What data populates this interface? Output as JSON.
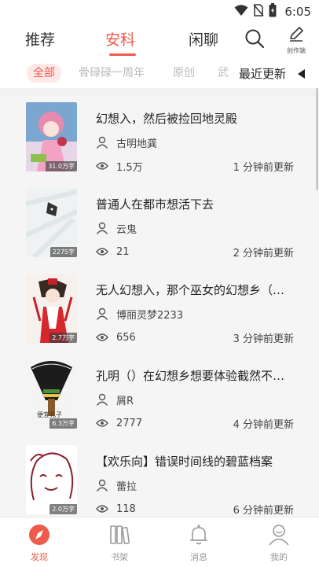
{
  "status_bar": {
    "time": "6:05"
  },
  "top_tabs": [
    {
      "label": "推荐",
      "active": false
    },
    {
      "label": "安科",
      "active": true
    },
    {
      "label": "闲聊",
      "active": false
    }
  ],
  "create_label": "创作端",
  "filters": [
    {
      "label": "全部",
      "active": true
    },
    {
      "label": "骨碌碌一周年",
      "active": false
    },
    {
      "label": "原创",
      "active": false
    },
    {
      "label": "武",
      "active": false
    }
  ],
  "sort_label": "最近更新",
  "books": [
    {
      "title": "幻想入，然后被捡回地灵殿",
      "author": "古明地龚",
      "views": "1.5万",
      "updated": "1 分钟前更新",
      "words": "31.0万字"
    },
    {
      "title": "普通人在都市想活下去",
      "author": "云鬼",
      "views": "21",
      "updated": "2 分钟前更新",
      "words": "2275字"
    },
    {
      "title": "无人幻想入，那个巫女的幻想乡（…",
      "author": "博丽灵梦2233",
      "views": "656",
      "updated": "3 分钟前更新",
      "words": "2.7万字"
    },
    {
      "title": "孔明（）在幻想乡想要体验截然不…",
      "author": "屑R",
      "views": "2777",
      "updated": "4 分钟前更新",
      "words": "6.3万字"
    },
    {
      "title": "【欢乐向】错误时间线的碧蓝档案",
      "author": "蕾拉",
      "views": "118",
      "updated": "6 分钟前更新",
      "words": "2.0万字"
    }
  ],
  "cover_texts": {
    "book4": "便宜孔子"
  },
  "bottom_nav": [
    {
      "label": "发现",
      "active": true
    },
    {
      "label": "书架",
      "active": false
    },
    {
      "label": "消息",
      "active": false
    },
    {
      "label": "我的",
      "active": false
    }
  ],
  "colors": {
    "accent": "#ee5a4c",
    "text": "#222222",
    "muted": "#999999",
    "list_bg": "#f5f5f5"
  }
}
